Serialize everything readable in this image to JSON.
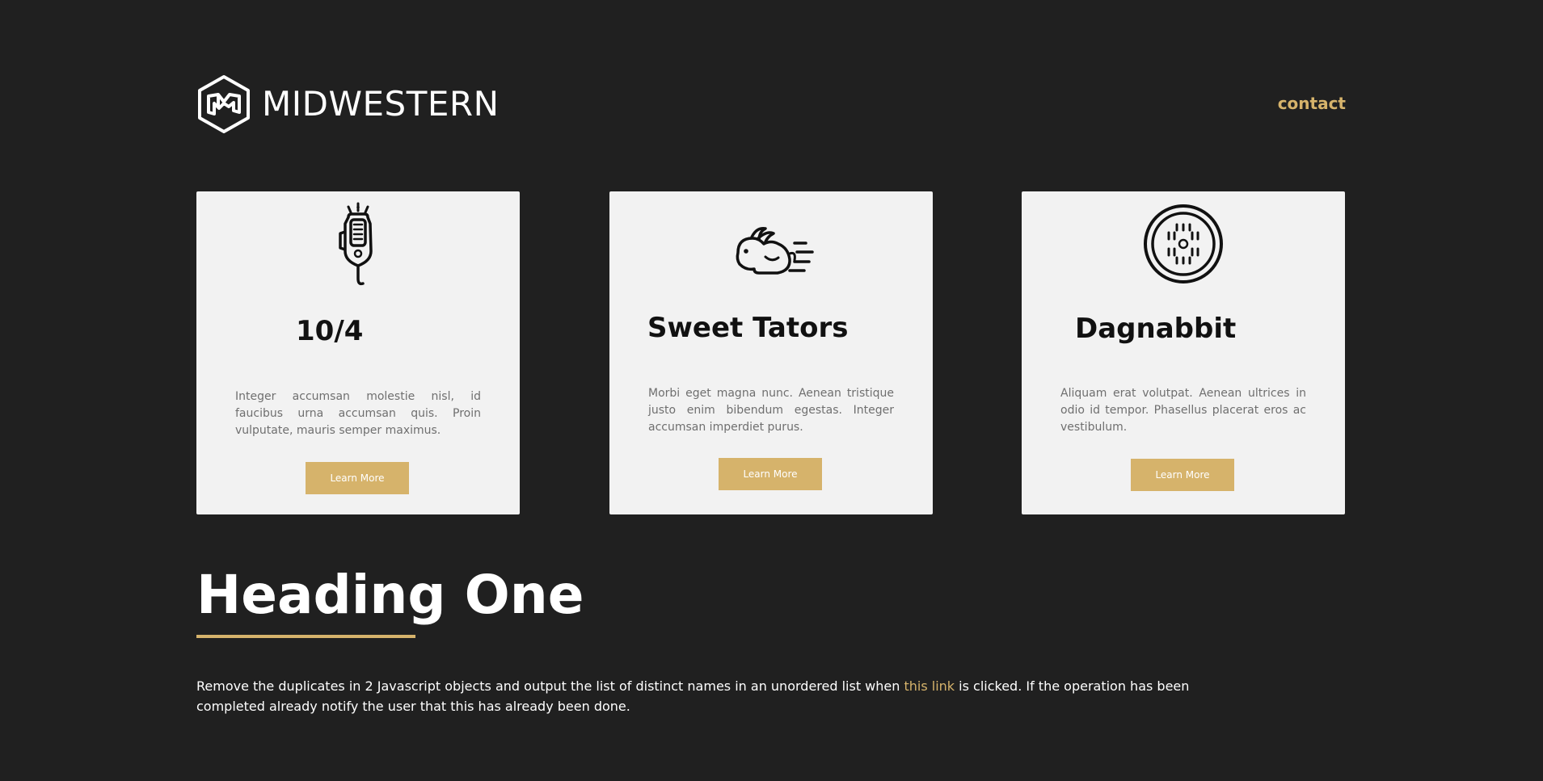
{
  "header": {
    "brand": "MIDWESTERN",
    "logo_icon": "midwestern-hexagon-logo",
    "contact_label": "contact"
  },
  "cards": [
    {
      "icon": "handheld-radio-icon",
      "title": "10/4",
      "text": "Integer accumsan molestie nisl, id faucibus urna accumsan quis. Proin vulputate, mauris semper maximus.",
      "button_label": "Learn More"
    },
    {
      "icon": "running-rabbit-icon",
      "title": "Sweet Tators",
      "text": "Morbi eget magna nunc. Aenean tristique justo enim bibendum egestas. Integer accumsan imperdiet purus.",
      "button_label": "Learn More"
    },
    {
      "icon": "manhole-cover-icon",
      "title": "Dagnabbit",
      "text": "Aliquam erat volutpat. Aenean ultrices in odio id tempor. Phasellus placerat eros ac vestibulum.",
      "button_label": "Learn More"
    }
  ],
  "section": {
    "heading": "Heading One",
    "paragraph_before_link": "Remove the duplicates in 2 Javascript objects and output the list of distinct names in an unordered list when ",
    "link_text": "this link",
    "paragraph_after_link": " is clicked. If the operation has been completed already notify the user that this has already been done."
  },
  "colors": {
    "background": "#202020",
    "card_background": "#f2f2f2",
    "accent": "#d6b36b",
    "text_light": "#ffffff",
    "text_muted": "#6f6f6f"
  }
}
